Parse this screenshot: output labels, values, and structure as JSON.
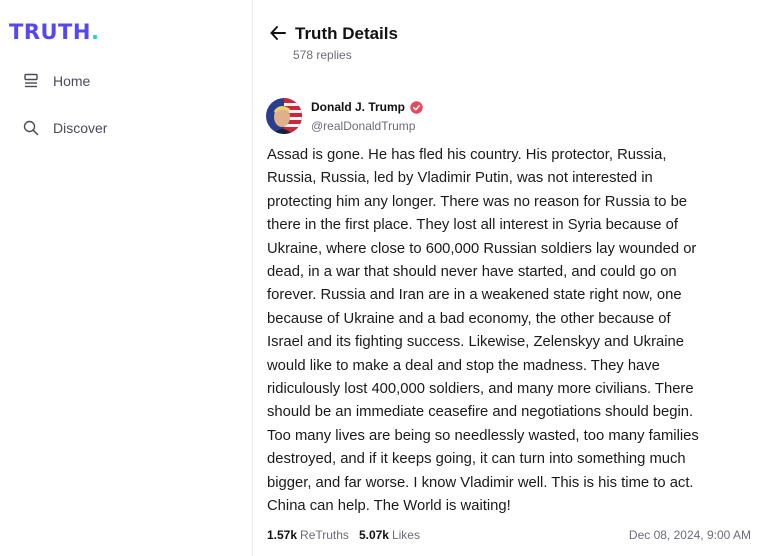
{
  "sidebar": {
    "logo_text": "TRUTH",
    "logo_dot": ".",
    "items": [
      {
        "label": "Home",
        "icon": "home-icon"
      },
      {
        "label": "Discover",
        "icon": "search-icon"
      }
    ]
  },
  "header": {
    "title": "Truth Details",
    "replies": "578 replies"
  },
  "post": {
    "author_name": "Donald J. Trump",
    "author_handle": "@realDonaldTrump",
    "body_lines": [
      "Assad is gone. He has fled his country. His protector, Russia,",
      "Russia, Russia, led by Vladimir Putin, was not interested in",
      "protecting him any longer. There was no reason for Russia to be",
      "there in the first place. They lost all interest in Syria because of",
      "Ukraine, where close to 600,000 Russian soldiers lay wounded or",
      "dead, in a war that should never have started, and could go on",
      "forever. Russia and Iran are in a weakened state right now, one",
      "because of Ukraine and a bad economy, the other because of",
      "Israel and its fighting success. Likewise, Zelenskyy and Ukraine",
      "would like to make a deal and stop the madness. They have",
      "ridiculously lost 400,000 soldiers, and many more civilians. There",
      "should be an immediate ceasefire and negotiations should begin.",
      "Too many lives are being so needlessly wasted, too many families",
      "destroyed, and if it keeps going, it can turn into something much",
      "bigger, and far worse. I know Vladimir well. This is his time to act.",
      "China can help. The World is waiting!"
    ],
    "retruths_count": "1.57k",
    "retruths_label": "ReTruths",
    "likes_count": "5.07k",
    "likes_label": "Likes",
    "timestamp": "Dec 08, 2024, 9:00 AM"
  },
  "colors": {
    "brand": "#5448ee",
    "brand_dot": "#30d0c4",
    "verified": "#e8495f"
  }
}
